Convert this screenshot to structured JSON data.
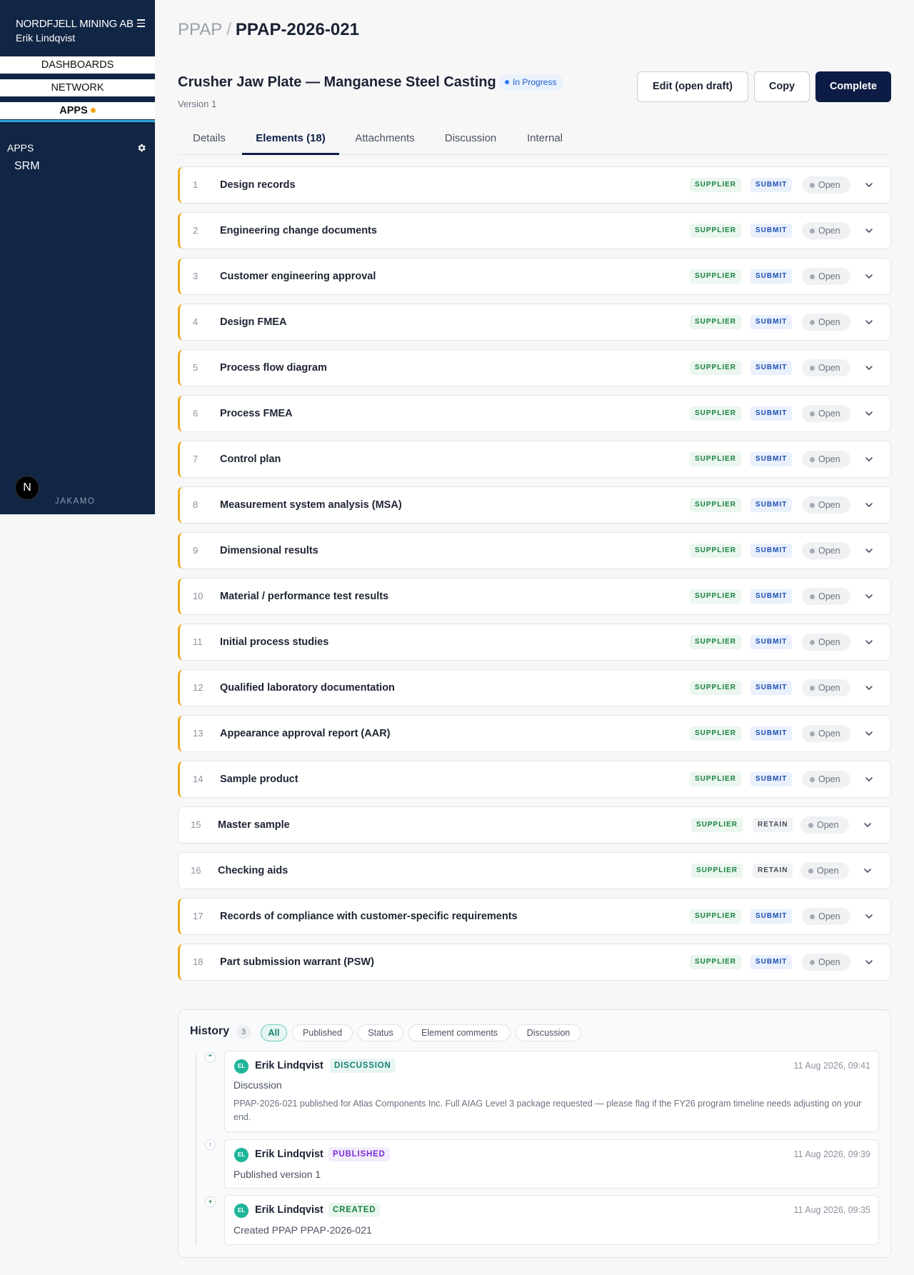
{
  "sidebar": {
    "company": "NORDFJELL MINING AB",
    "user": "Erik Lindqvist",
    "nav": [
      "DASHBOARDS",
      "NETWORK",
      "APPS"
    ],
    "apps_label": "APPS",
    "app_item": "SRM",
    "logo_letter": "N",
    "brand": "JAKAMO"
  },
  "breadcrumb": {
    "root": "PPAP",
    "separator": "/",
    "current": "PPAP-2026-021"
  },
  "header": {
    "title": "Crusher Jaw Plate — Manganese Steel Casting",
    "status": "In Progress",
    "version": "Version 1",
    "buttons": {
      "edit": "Edit (open draft)",
      "copy": "Copy",
      "complete": "Complete"
    }
  },
  "tabs": [
    "Details",
    "Elements (18)",
    "Attachments",
    "Discussion",
    "Internal"
  ],
  "elements": [
    {
      "num": "1",
      "label": "Design records",
      "role": "SUPPLIER",
      "action": "SUBMIT",
      "status": "Open"
    },
    {
      "num": "2",
      "label": "Engineering change documents",
      "role": "SUPPLIER",
      "action": "SUBMIT",
      "status": "Open"
    },
    {
      "num": "3",
      "label": "Customer engineering approval",
      "role": "SUPPLIER",
      "action": "SUBMIT",
      "status": "Open"
    },
    {
      "num": "4",
      "label": "Design FMEA",
      "role": "SUPPLIER",
      "action": "SUBMIT",
      "status": "Open"
    },
    {
      "num": "5",
      "label": "Process flow diagram",
      "role": "SUPPLIER",
      "action": "SUBMIT",
      "status": "Open"
    },
    {
      "num": "6",
      "label": "Process FMEA",
      "role": "SUPPLIER",
      "action": "SUBMIT",
      "status": "Open"
    },
    {
      "num": "7",
      "label": "Control plan",
      "role": "SUPPLIER",
      "action": "SUBMIT",
      "status": "Open"
    },
    {
      "num": "8",
      "label": "Measurement system analysis (MSA)",
      "role": "SUPPLIER",
      "action": "SUBMIT",
      "status": "Open"
    },
    {
      "num": "9",
      "label": "Dimensional results",
      "role": "SUPPLIER",
      "action": "SUBMIT",
      "status": "Open"
    },
    {
      "num": "10",
      "label": "Material / performance test results",
      "role": "SUPPLIER",
      "action": "SUBMIT",
      "status": "Open"
    },
    {
      "num": "11",
      "label": "Initial process studies",
      "role": "SUPPLIER",
      "action": "SUBMIT",
      "status": "Open"
    },
    {
      "num": "12",
      "label": "Qualified laboratory documentation",
      "role": "SUPPLIER",
      "action": "SUBMIT",
      "status": "Open"
    },
    {
      "num": "13",
      "label": "Appearance approval report (AAR)",
      "role": "SUPPLIER",
      "action": "SUBMIT",
      "status": "Open"
    },
    {
      "num": "14",
      "label": "Sample product",
      "role": "SUPPLIER",
      "action": "SUBMIT",
      "status": "Open"
    },
    {
      "num": "15",
      "label": "Master sample",
      "role": "SUPPLIER",
      "action": "RETAIN",
      "status": "Open"
    },
    {
      "num": "16",
      "label": "Checking aids",
      "role": "SUPPLIER",
      "action": "RETAIN",
      "status": "Open"
    },
    {
      "num": "17",
      "label": "Records of compliance with customer-specific requirements",
      "role": "SUPPLIER",
      "action": "SUBMIT",
      "status": "Open"
    },
    {
      "num": "18",
      "label": "Part submission warrant (PSW)",
      "role": "SUPPLIER",
      "action": "SUBMIT",
      "status": "Open"
    }
  ],
  "history": {
    "title": "History",
    "count": "3",
    "filters": [
      "All",
      "Published",
      "Status",
      "Element comments",
      "Discussion"
    ],
    "entries": [
      {
        "initials": "EL",
        "author": "Erik Lindqvist",
        "type": "DISCUSSION",
        "time": "11 Aug 2026, 09:41",
        "summary": "Discussion",
        "body": "PPAP-2026-021 published for Atlas Components Inc. Full AIAG Level 3 package requested — please flag if the FY26 program timeline needs adjusting on your end."
      },
      {
        "initials": "EL",
        "author": "Erik Lindqvist",
        "type": "PUBLISHED",
        "time": "11 Aug 2026, 09:39",
        "summary": "Published version 1"
      },
      {
        "initials": "EL",
        "author": "Erik Lindqvist",
        "type": "CREATED",
        "time": "11 Aug 2026, 09:35",
        "summary": "Created PPAP PPAP-2026-021"
      }
    ]
  },
  "colors": {
    "sidebar_bg": "#112544",
    "primary": "#0c1c44",
    "row_accent": "#f0a91b",
    "supplier_tag": "#17803d",
    "submit_tag": "#1d4fb3",
    "status_in_progress": "#1c5cc7",
    "discussion_badge": "#14806e",
    "published_badge": "#7b2fd6",
    "created_badge": "#17803d"
  }
}
